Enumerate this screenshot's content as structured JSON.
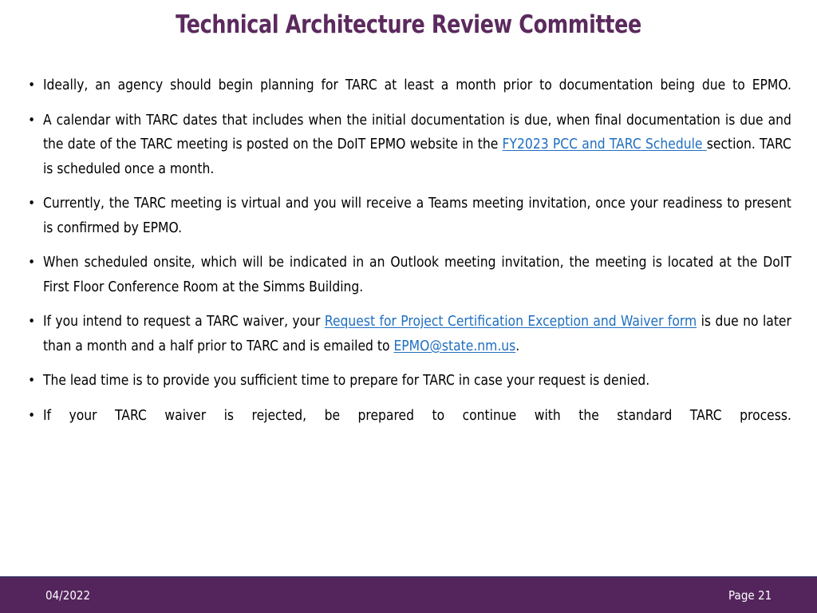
{
  "slide": {
    "title": "Technical Architecture Review Committee",
    "title_color": "#5B2A5E",
    "background_color": "#FFFFFF",
    "link_color": "#1F6FC0",
    "text_color": "#000000"
  },
  "bullets": [
    {
      "id": "bullet-planning-lead-time",
      "marker": "•",
      "segments": [
        {
          "type": "text",
          "text": "Ideally, an agency should begin planning for TARC at least a month prior to documentation being due to EPMO."
        }
      ]
    },
    {
      "id": "bullet-tarc-calendar",
      "marker": "•",
      "segments": [
        {
          "type": "text",
          "text": "A calendar with TARC dates that includes when the initial documentation is due, when final documentation is due and the date of the TARC meeting is posted on the DoIT EPMO website in the "
        },
        {
          "type": "link",
          "text": "FY2023 PCC and TARC Schedule ",
          "name": "fy2023-pcc-tarc-schedule-link"
        },
        {
          "type": "text",
          "text": "section.  TARC is scheduled once a month."
        }
      ]
    },
    {
      "id": "bullet-virtual-meeting",
      "marker": "•",
      "segments": [
        {
          "type": "text",
          "text": "Currently, the TARC meeting is virtual and you will receive a Teams meeting invitation, once your readiness to present is confirmed by EPMO."
        }
      ]
    },
    {
      "id": "bullet-onsite-location",
      "marker": "•",
      "segments": [
        {
          "type": "text",
          "text": "When scheduled onsite, which will be indicated in an Outlook meeting invitation, the meeting is located at the DoIT First Floor Conference Room at the Simms Building."
        }
      ]
    },
    {
      "id": "bullet-tarc-waiver",
      "marker": "•",
      "segments": [
        {
          "type": "text",
          "text": "If you intend to request a TARC waiver, your "
        },
        {
          "type": "link",
          "text": "Request for Project Certification Exception and Waiver form",
          "name": "waiver-form-link"
        },
        {
          "type": "text",
          "text": " is due no later than a month and a half prior to TARC and is emailed to "
        },
        {
          "type": "link",
          "text": "EPMO@state.nm.us",
          "name": "epmo-email-link"
        },
        {
          "type": "text",
          "text": "."
        }
      ]
    },
    {
      "id": "bullet-lead-time-reason",
      "marker": "•",
      "segments": [
        {
          "type": "text",
          "text": "The lead time is to provide you sufficient time to prepare for TARC in case your request is denied."
        }
      ]
    },
    {
      "id": "bullet-waiver-rejected",
      "marker": "•",
      "segments": [
        {
          "type": "text",
          "text": "If your TARC waiver is rejected, be prepared to continue with the standard TARC process."
        }
      ]
    }
  ],
  "footer": {
    "date": "04/2022",
    "page": "Page 21",
    "background_color": "#54245C",
    "text_color": "#FFFFFF"
  }
}
